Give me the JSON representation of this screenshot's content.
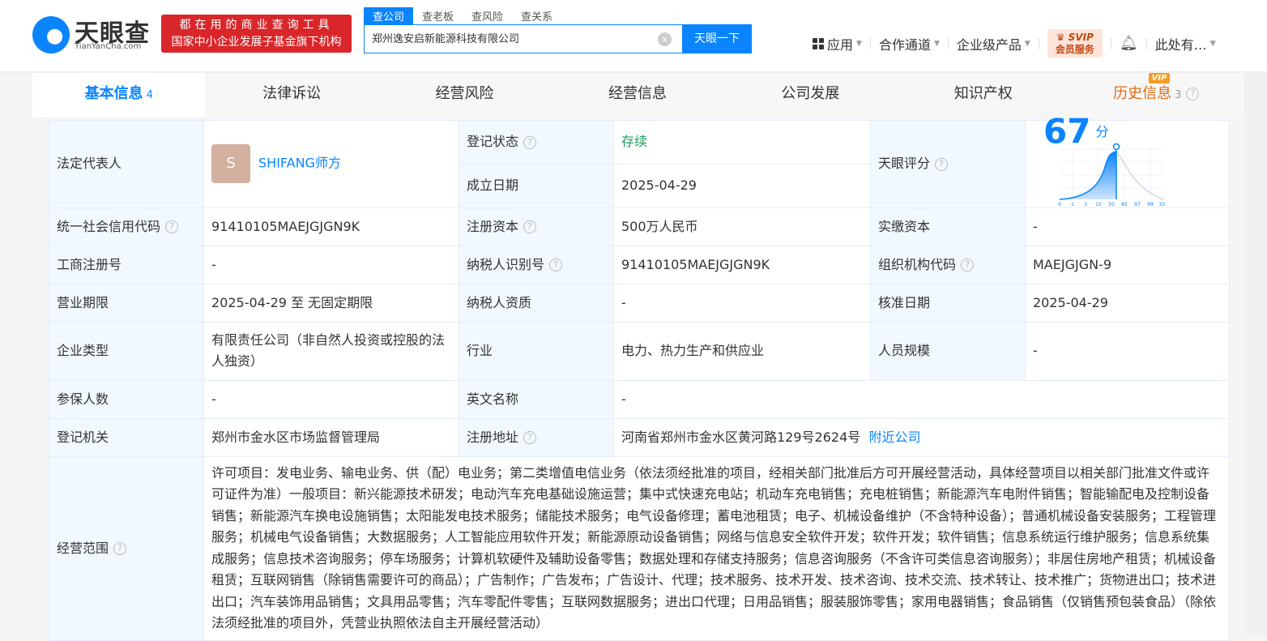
{
  "brand": {
    "name": "天眼查",
    "domain": "TianYanCha.com"
  },
  "slogan": {
    "line1": "都在用的商业查询工具",
    "line2": "国家中小企业发展子基金旗下机构"
  },
  "search": {
    "tabs": [
      "查公司",
      "查老板",
      "查风险",
      "查关系"
    ],
    "value": "郑州逸安启新能源科技有限公司",
    "clear": "x",
    "button": "天眼一下"
  },
  "nav": {
    "apps": "应用",
    "partner": "合作通道",
    "enterprise": "企业级产品",
    "svip_top": "SVIP",
    "svip_bottom": "会员服务",
    "user": "此处有…"
  },
  "tabs": [
    {
      "label": "基本信息",
      "count": "4"
    },
    {
      "label": "法律诉讼"
    },
    {
      "label": "经营风险"
    },
    {
      "label": "经营信息"
    },
    {
      "label": "公司发展"
    },
    {
      "label": "知识产权"
    },
    {
      "label": "历史信息",
      "count": "3",
      "badge": "VIP"
    }
  ],
  "info": {
    "legal_rep_label": "法定代表人",
    "legal_rep_avatar": "S",
    "legal_rep": "SHIFANG师方",
    "status_label": "登记状态",
    "status": "存续",
    "founded_label": "成立日期",
    "founded": "2025-04-29",
    "score_label": "天眼评分",
    "score": "67",
    "score_unit": "分",
    "score_axis": [
      "0",
      "1",
      "3",
      "15",
      "50",
      "85",
      "97",
      "99",
      "100"
    ],
    "credit_code_label": "统一社会信用代码",
    "credit_code": "91410105MAEJGJGN9K",
    "reg_capital_label": "注册资本",
    "reg_capital": "500万人民币",
    "paid_capital_label": "实缴资本",
    "paid_capital": "-",
    "biz_reg_no_label": "工商注册号",
    "biz_reg_no": "-",
    "taxpayer_id_label": "纳税人识别号",
    "taxpayer_id": "91410105MAEJGJGN9K",
    "org_code_label": "组织机构代码",
    "org_code": "MAEJGJGN-9",
    "term_label": "营业期限",
    "term": "2025-04-29 至 无固定期限",
    "taxpayer_qual_label": "纳税人资质",
    "taxpayer_qual": "-",
    "approved_label": "核准日期",
    "approved": "2025-04-29",
    "type_label": "企业类型",
    "type": "有限责任公司（非自然人投资或控股的法人独资）",
    "industry_label": "行业",
    "industry": "电力、热力生产和供应业",
    "staff_label": "人员规模",
    "staff": "-",
    "insured_label": "参保人数",
    "insured": "-",
    "english_label": "英文名称",
    "english": "-",
    "authority_label": "登记机关",
    "authority": "郑州市金水区市场监督管理局",
    "address_label": "注册地址",
    "address": "河南省郑州市金水区黄河路129号2624号",
    "nearby": "附近公司",
    "scope_label": "经营范围",
    "scope": "许可项目：发电业务、输电业务、供（配）电业务；第二类增值电信业务（依法须经批准的项目，经相关部门批准后方可开展经营活动，具体经营项目以相关部门批准文件或许可证件为准）一般项目：新兴能源技术研发；电动汽车充电基础设施运营；集中式快速充电站；机动车充电销售；充电桩销售；新能源汽车电附件销售；智能输配电及控制设备销售；新能源汽车换电设施销售；太阳能发电技术服务；储能技术服务；电气设备修理；蓄电池租赁；电子、机械设备维护（不含特种设备）；普通机械设备安装服务；工程管理服务；机械电气设备销售；大数据服务；人工智能应用软件开发；新能源原动设备销售；网络与信息安全软件开发；软件开发；软件销售；信息系统运行维护服务；信息系统集成服务；信息技术咨询服务；停车场服务；计算机软硬件及辅助设备零售；数据处理和存储支持服务；信息咨询服务（不含许可类信息咨询服务）；非居住房地产租赁；机械设备租赁；互联网销售（除销售需要许可的商品）；广告制作；广告发布；广告设计、代理；技术服务、技术开发、技术咨询、技术交流、技术转让、技术推广；货物进出口；技术进出口；汽车装饰用品销售；文具用品零售；汽车零配件零售；互联网数据服务；进出口代理；日用品销售；服装服饰零售；家用电器销售；食品销售（仅销售预包装食品）（除依法须经批准的项目外，凭营业执照依法自主开展经营活动）"
  },
  "colors": {
    "primary": "#0a84ff",
    "slogan_bg": "#d9262a",
    "history": "#e36b10",
    "status": "#17a05d"
  }
}
